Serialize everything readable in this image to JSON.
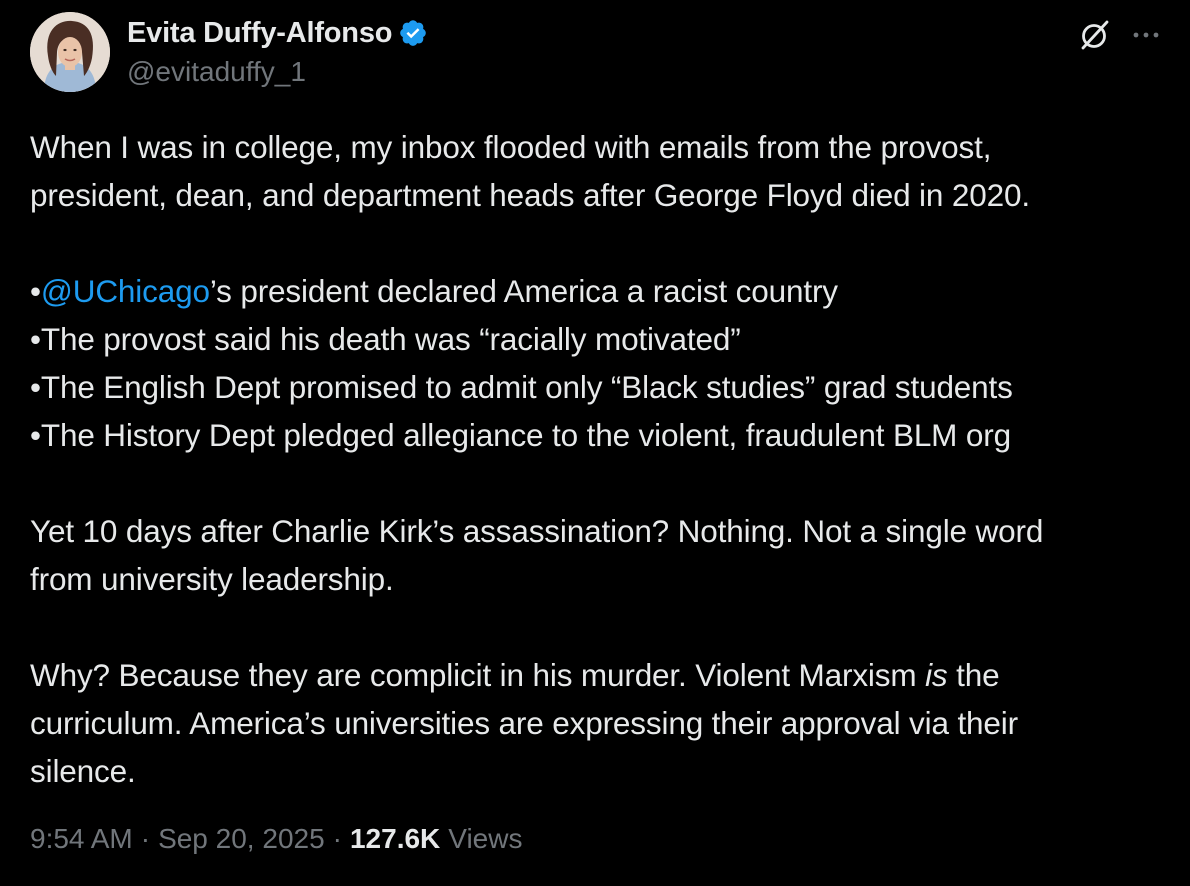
{
  "author": {
    "display_name": "Evita Duffy-Alfonso",
    "handle": "@evitaduffy_1",
    "verified": true,
    "verified_color": "#1d9bf0"
  },
  "icons": {
    "top_right": [
      "grok-icon",
      "more-icon"
    ],
    "verified": "verified-badge-icon"
  },
  "tweet": {
    "p1_l1": "When I was in college, my inbox flooded with emails from the provost,",
    "p1_l2": "president, dean, and department heads after George Floyd died in 2020.",
    "bullet_1_prefix": "•",
    "bullet_1_mention": "@UChicago",
    "bullet_1_rest": "’s president declared America a racist country",
    "bullet_2": "•The provost said his death was “racially motivated”",
    "bullet_3": "•The English Dept promised to admit only “Black studies” grad students",
    "bullet_4": "•The History Dept pledged allegiance to the violent, fraudulent BLM org",
    "p3_l1": "Yet 10 days after Charlie Kirk’s assassination? Nothing. Not a single word",
    "p3_l2": "from university leadership.",
    "p4_l1_a": "Why? Because they are complicit in his murder. Violent Marxism ",
    "p4_l1_em": "is",
    "p4_l1_b": " the",
    "p4_l2": "curriculum. America’s universities are expressing their approval via their",
    "p4_l3": "silence."
  },
  "meta": {
    "time": "9:54 AM",
    "separator": "·",
    "date": "Sep 20, 2025",
    "views_count": "127.6K",
    "views_label": "Views"
  },
  "colors": {
    "background": "#000000",
    "text": "#e7e9ea",
    "secondary": "#71767b",
    "link": "#1d9bf0"
  }
}
